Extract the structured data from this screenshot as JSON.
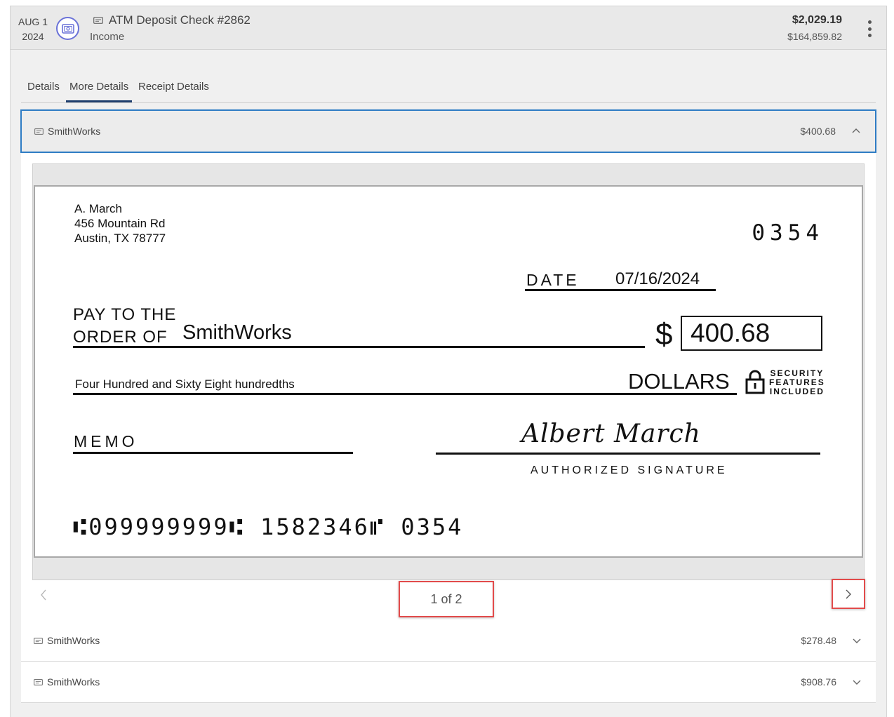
{
  "transaction": {
    "date_month_day": "AUG 1",
    "date_year": "2024",
    "title": "ATM Deposit Check #2862",
    "category": "Income",
    "amount": "$2,029.19",
    "balance": "$164,859.82"
  },
  "tabs": [
    {
      "label": "Details",
      "active": false
    },
    {
      "label": "More Details",
      "active": true
    },
    {
      "label": "Receipt Details",
      "active": false
    }
  ],
  "checks": [
    {
      "payee": "SmithWorks",
      "amount": "$400.68",
      "expanded": true
    },
    {
      "payee": "SmithWorks",
      "amount": "$278.48",
      "expanded": false
    },
    {
      "payee": "SmithWorks",
      "amount": "$908.76",
      "expanded": false
    }
  ],
  "check_image": {
    "drawer_line1": "A. March",
    "drawer_line2": "456 Mountain Rd",
    "drawer_line3": "Austin, TX 78777",
    "check_number": "0354",
    "date_label": "DATE",
    "date_value": "07/16/2024",
    "pay_line1": "PAY TO THE",
    "pay_line2": "ORDER OF",
    "payee": "SmithWorks",
    "dollar_sign": "$",
    "amount": "400.68",
    "amount_words": "Four Hundred and Sixty Eight hundredths",
    "dollars_label": "DOLLARS",
    "security_line1": "SECURITY",
    "security_line2": "FEATURES",
    "security_line3": "INCLUDED",
    "memo_label": "MEMO",
    "signature": "Albert March",
    "signature_label": "AUTHORIZED SIGNATURE",
    "micr": "⑆099999999⑆ 1582346⑈ 0354"
  },
  "pagination": {
    "indicator": "1 of 2"
  },
  "colors": {
    "accent_blue": "#2e7cc4",
    "icon_purple": "#6a72d8",
    "highlight_red": "#e24b4b",
    "tab_underline": "#1f3f6e"
  }
}
